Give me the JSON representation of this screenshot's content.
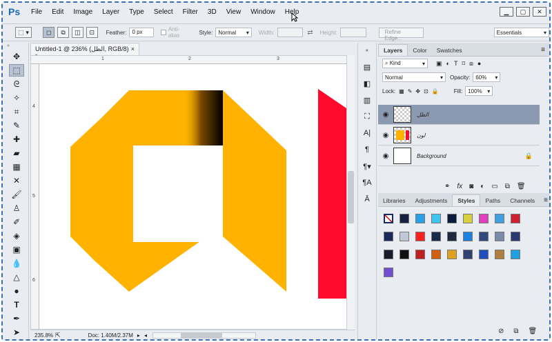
{
  "app": {
    "logo": "Ps"
  },
  "menu": [
    "File",
    "Edit",
    "Image",
    "Layer",
    "Type",
    "Select",
    "Filter",
    "3D",
    "View",
    "Window",
    "Help"
  ],
  "window_controls": [
    "minimize-icon",
    "maximize-icon",
    "close-icon"
  ],
  "options": {
    "feather_label": "Feather:",
    "feather_value": "0 px",
    "antialias_label": "Anti-alias",
    "style_label": "Style:",
    "style_value": "Normal",
    "width_label": "Width:",
    "height_label": "Height:",
    "refine_label": "Refine Edge...",
    "workspace_value": "Essentials"
  },
  "document": {
    "tab_title": "Untitled-1 @ 236% (الظل, RGB/8) *",
    "close_glyph": "×",
    "ruler_h": [
      "1",
      "2",
      "3"
    ],
    "ruler_v": [
      "4",
      "5",
      "6"
    ],
    "zoom": "235.8%",
    "doc_info": "Doc: 1.40M/2.37M",
    "colors": {
      "yellow": "#ffb300",
      "red": "#ff0a2c",
      "black": "#000000"
    }
  },
  "panel": {
    "tabs": [
      "Layers",
      "Color",
      "Swatches"
    ],
    "filter_label": "Kind",
    "blend_mode": "Normal",
    "opacity_label": "Opacity:",
    "opacity_value": "60%",
    "lock_label": "Lock:",
    "fill_label": "Fill:",
    "fill_value": "100%",
    "layers": [
      {
        "name": "الظل",
        "selected": true
      },
      {
        "name": "لون",
        "selected": false
      },
      {
        "name": "Background",
        "selected": false
      }
    ],
    "bottom_tabs": [
      "Libraries",
      "Adjustments",
      "Styles",
      "Paths",
      "Channels"
    ],
    "style_swatch_colors": [
      "#ffffff",
      "#15223f",
      "#2aa0e8",
      "#3fc4f0",
      "#0c1b3d",
      "#d8d040",
      "#e040c0",
      "#40a0e0",
      "#d02030",
      "#1a2a5a",
      "#c0c8d8",
      "#ff2020",
      "#1a2a4a",
      "#202840",
      "#2080e0",
      "#304a80",
      "#7a8aa8",
      "#2a3a70",
      "#1a1a2a",
      "#101010",
      "#c02020",
      "#d06010",
      "#e0a020",
      "#304070",
      "#2050c0",
      "#b08040",
      "#20a0e0",
      "#7050d0"
    ]
  }
}
